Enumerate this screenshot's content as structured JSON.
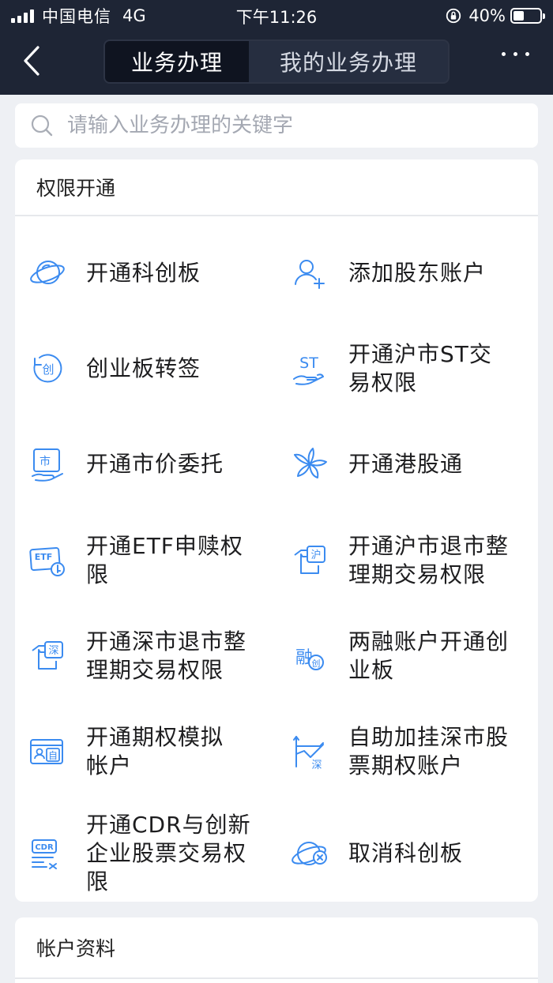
{
  "status_bar": {
    "carrier": "中国电信",
    "network": "4G",
    "time": "下午11:26",
    "battery": "40%",
    "battery_level": 0.4
  },
  "nav": {
    "tabs": [
      {
        "label": "业务办理",
        "active": true
      },
      {
        "label": "我的业务办理",
        "active": false
      }
    ]
  },
  "search": {
    "placeholder": "请输入业务办理的关键字"
  },
  "sections": [
    {
      "title": "权限开通",
      "items": [
        {
          "label": "开通科创板",
          "icon": "planet-icon"
        },
        {
          "label": "添加股东账户",
          "icon": "add-user-icon"
        },
        {
          "label": "创业板转签",
          "icon": "chuang-rotate-icon"
        },
        {
          "label": "开通沪市ST交易权限",
          "icon": "st-hand-icon"
        },
        {
          "label": "开通市价委托",
          "icon": "market-hand-icon"
        },
        {
          "label": "开通港股通",
          "icon": "bauhinia-icon"
        },
        {
          "label": "开通ETF申赎权限",
          "icon": "etf-key-icon"
        },
        {
          "label": "开通沪市退市整理期交易权限",
          "icon": "hu-tshirt-icon"
        },
        {
          "label": "开通深市退市整理期交易权限",
          "icon": "shen-tshirt-icon"
        },
        {
          "label": "两融账户开通创业板",
          "icon": "rong-chuang-icon"
        },
        {
          "label": "开通期权模拟帐户",
          "icon": "id-card-icon"
        },
        {
          "label": "自助加挂深市股票期权账户",
          "icon": "shen-chart-icon"
        },
        {
          "label": "开通CDR与创新企业股票交易权限",
          "icon": "cdr-icon"
        },
        {
          "label": "取消科创板",
          "icon": "planet-cancel-icon"
        }
      ]
    },
    {
      "title": "帐户资料"
    }
  ],
  "colors": {
    "header_bg": "#1e2535",
    "icon_blue": "#3b8bf0",
    "page_bg": "#eef0f4"
  }
}
